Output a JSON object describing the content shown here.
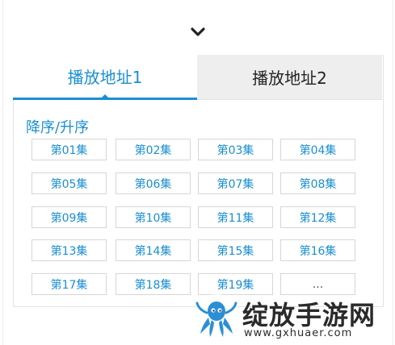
{
  "tabs": [
    {
      "label": "播放地址1",
      "active": true
    },
    {
      "label": "播放地址2",
      "active": false
    }
  ],
  "sort_label": "降序/升序",
  "episodes": [
    "第01集",
    "第02集",
    "第03集",
    "第04集",
    "第05集",
    "第06集",
    "第07集",
    "第08集",
    "第09集",
    "第10集",
    "第11集",
    "第12集",
    "第13集",
    "第14集",
    "第15集",
    "第16集",
    "第17集",
    "第18集",
    "第19集",
    "..."
  ],
  "watermark": {
    "title": "绽放手游网",
    "url": "www.gxhuaer.com"
  },
  "colors": {
    "accent": "#1a8fd1",
    "inactive_tab_bg": "#eeeeee"
  },
  "icons": {
    "expand": "chevron-down-icon"
  }
}
